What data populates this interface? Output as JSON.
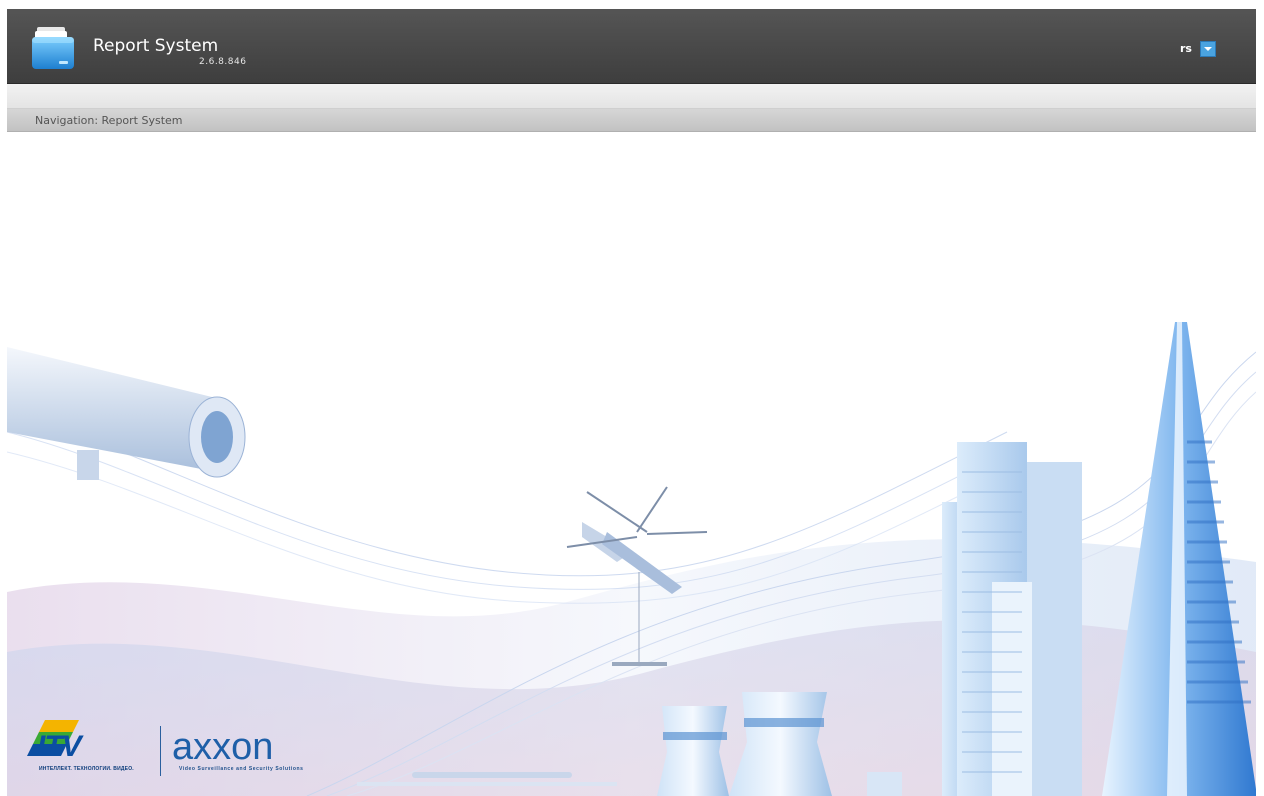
{
  "header": {
    "title": "Report System",
    "version": "2.6.8.846",
    "user": "rs"
  },
  "navigation": {
    "label": "Navigation: Report System"
  },
  "logos": {
    "itv": "ITV",
    "itv_tagline": "ИНТЕЛЛЕКТ. ТЕХНОЛОГИИ. ВИДЕО.",
    "axxon": "axxon",
    "axxon_tagline": "Video Surveillance and Security Solutions"
  },
  "colors": {
    "header_bg": "#474747",
    "accent": "#4aa3e0",
    "brand_blue": "#1e5fa8"
  }
}
